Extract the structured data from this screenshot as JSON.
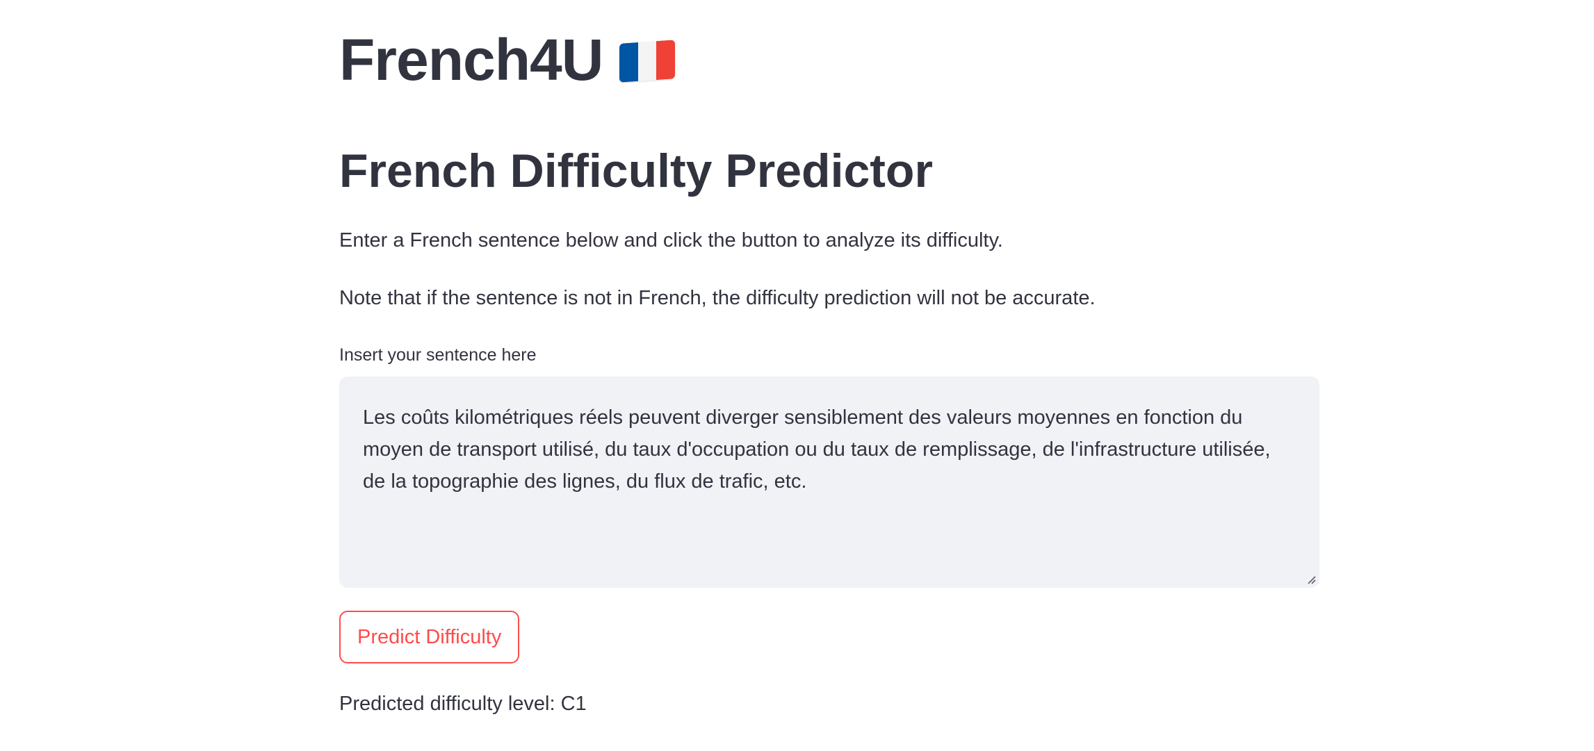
{
  "header": {
    "app_title": "French4U",
    "flag_icon": "french-flag-icon",
    "flag_colors": [
      "#0055a4",
      "#ffffff",
      "#ef4135"
    ]
  },
  "main": {
    "heading": "French Difficulty Predictor",
    "instructions": "Enter a French sentence below and click the button to analyze its difficulty.",
    "note": "Note that if the sentence is not in French, the difficulty prediction will not be accurate.",
    "input_label": "Insert your sentence here",
    "input_value": "Les coûts kilométriques réels peuvent diverger sensiblement des valeurs moyennes en fonction du moyen de transport utilisé, du taux d'occupation ou du taux de remplissage, de l'infrastructure utilisée, de la topographie des lignes, du flux de trafic, etc.",
    "button_label": "Predict Difficulty",
    "result_text": "Predicted difficulty level: C1"
  },
  "colors": {
    "text": "#31333f",
    "accent": "#ff4b4b",
    "input_background": "#f0f2f6"
  }
}
